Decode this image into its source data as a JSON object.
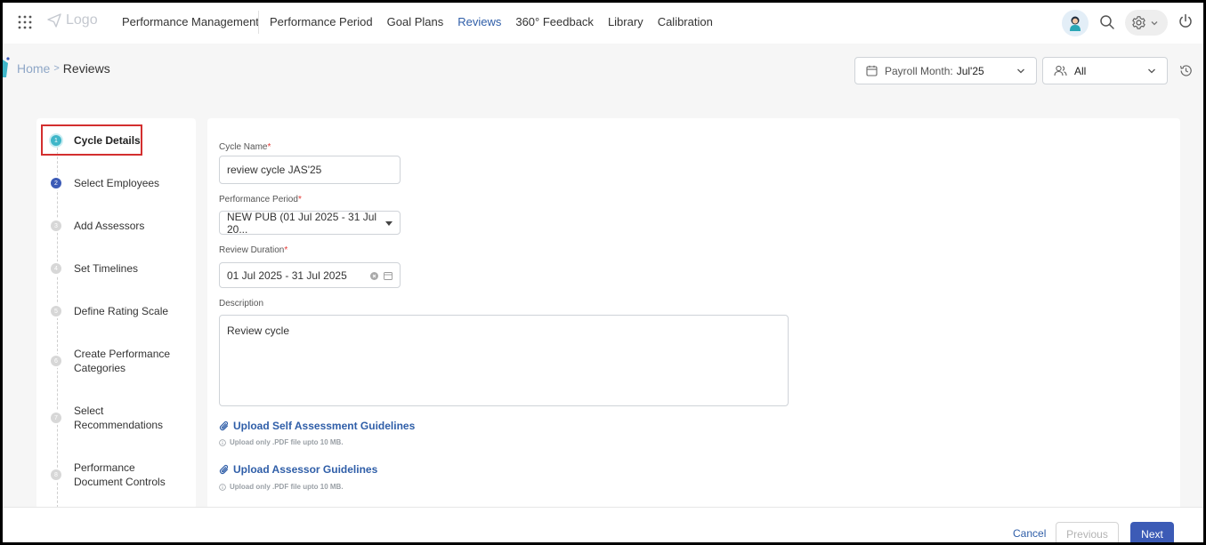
{
  "app": {
    "logo_text": "Logo",
    "module": "Performance Management"
  },
  "nav": {
    "tabs": [
      {
        "label": "Performance Period",
        "active": false
      },
      {
        "label": "Goal Plans",
        "active": false
      },
      {
        "label": "Reviews",
        "active": true
      },
      {
        "label": "360° Feedback",
        "active": false
      },
      {
        "label": "Library",
        "active": false
      },
      {
        "label": "Calibration",
        "active": false
      }
    ]
  },
  "breadcrumb": {
    "home": "Home",
    "separator": ">",
    "current": "Reviews"
  },
  "filters": {
    "payroll_label": "Payroll Month:",
    "payroll_value": "Jul'25",
    "group_value": "All"
  },
  "stepper": {
    "steps": [
      {
        "num": "1",
        "label": "Cycle Details"
      },
      {
        "num": "2",
        "label": "Select Employees"
      },
      {
        "num": "3",
        "label": "Add Assessors"
      },
      {
        "num": "4",
        "label": "Set Timelines"
      },
      {
        "num": "5",
        "label": "Define Rating Scale"
      },
      {
        "num": "6",
        "label": "Create Performance Categories"
      },
      {
        "num": "7",
        "label": "Select Recommendations"
      },
      {
        "num": "8",
        "label": "Performance Document Controls"
      }
    ]
  },
  "form": {
    "cycle_name_label": "Cycle Name",
    "cycle_name_value": "review cycle JAS'25",
    "period_label": "Performance Period",
    "period_value": "NEW PUB (01 Jul 2025 - 31 Jul 20...",
    "duration_label": "Review Duration",
    "duration_value": "01 Jul 2025 - 31 Jul 2025",
    "description_label": "Description",
    "description_value": "Review cycle",
    "required_mark": "*",
    "upload_self": "Upload Self Assessment Guidelines",
    "upload_assessor": "Upload Assessor Guidelines",
    "upload_hint": "Upload only .PDF file upto 10 MB."
  },
  "footer": {
    "cancel": "Cancel",
    "previous": "Previous",
    "next": "Next"
  },
  "colors": {
    "accent": "#2f5ea8",
    "primary_button": "#3c5bb6",
    "current_step": "#3fb6c8",
    "highlight_box": "#d32f2f"
  }
}
